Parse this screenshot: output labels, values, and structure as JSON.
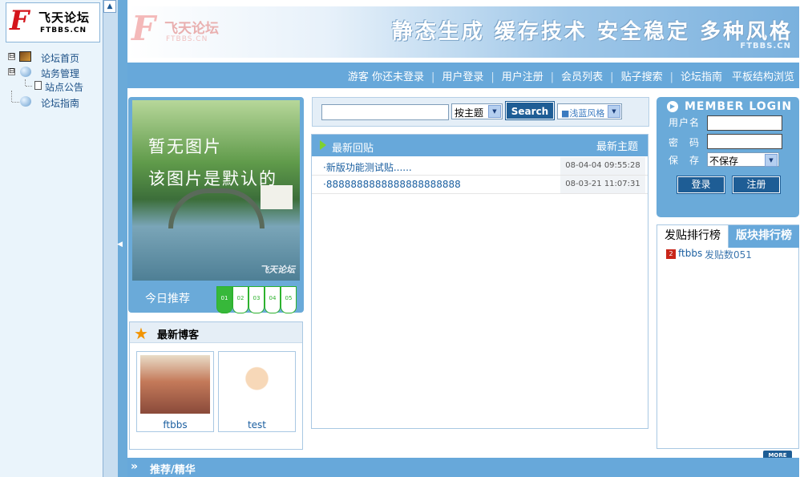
{
  "sidebar": {
    "logo": {
      "mark": "F",
      "title": "飞天论坛",
      "domain": "FTBBS.CN"
    },
    "collapse_glyph": "▲",
    "divider_glyph": "◀",
    "tree": [
      {
        "label": "论坛首页",
        "expander": "⊟"
      },
      {
        "label": "站务管理",
        "expander": "⊟"
      },
      {
        "label": "站点公告"
      },
      {
        "label": "论坛指南"
      }
    ]
  },
  "banner": {
    "logo_mark": "F",
    "logo_title": "飞天论坛",
    "logo_domain": "FTBBS.CN",
    "slogan": "静态生成 缓存技术 安全稳定 多种风格",
    "url": "FTBBS.CN"
  },
  "nav": {
    "items": [
      "游客 你还未登录",
      "用户登录",
      "用户注册",
      "会员列表",
      "贴子搜索",
      "论坛指南",
      "平板结构浏览"
    ]
  },
  "featured": {
    "line1": "暂无图片",
    "line2": "该图片是默认的",
    "watermark": "飞天论坛",
    "today_label": "今日推荐",
    "pages": [
      "01",
      "02",
      "03",
      "04",
      "05"
    ],
    "active_page": 0
  },
  "blogs": {
    "title": "最新博客",
    "items": [
      {
        "name": "ftbbs"
      },
      {
        "name": "test"
      }
    ]
  },
  "search": {
    "query": "",
    "mode": "按主题",
    "button": "Search",
    "style": "■浅蓝风格"
  },
  "posts": {
    "header_left": "最新回贴",
    "header_right": "最新主题",
    "rows": [
      {
        "title": "·新版功能测试贴......",
        "date": "08-04-04 09:55:28"
      },
      {
        "title": "·8888888888888888888888",
        "date": "08-03-21 11:07:31"
      }
    ]
  },
  "login": {
    "title": "MEMBER LOGIN",
    "username_label": "用户名",
    "password_label": "密　码",
    "save_label": "保　存",
    "save_value": "不保存",
    "login_button": "登录",
    "register_button": "注册"
  },
  "rank": {
    "tab_posts": "发贴排行榜",
    "tab_boards": "版块排行榜",
    "entries": [
      {
        "badge": "2",
        "name": "ftbbs",
        "value": "发贴数051"
      }
    ]
  },
  "more_label": "MORE",
  "recommend": {
    "title": "推荐/精华",
    "chevron": "»"
  },
  "colors": {
    "accent": "#67a8da",
    "button": "#1e5d95",
    "green": "#37b83a"
  }
}
